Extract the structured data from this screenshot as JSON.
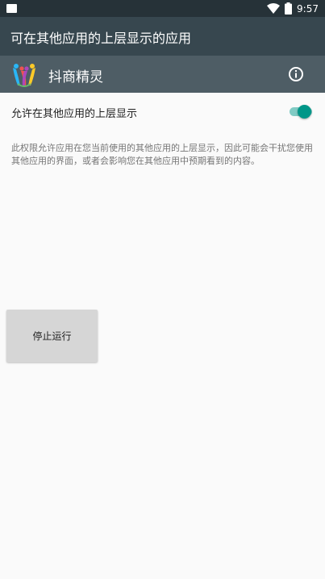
{
  "status_bar": {
    "time": "9:57",
    "icons": [
      "sd-card-icon",
      "wifi-icon",
      "battery-icon"
    ]
  },
  "toolbar": {
    "title": "可在其他应用的上层显示的应用"
  },
  "app": {
    "name": "抖商精灵",
    "icon": "app-logo-icon",
    "info_icon": "info-icon"
  },
  "setting": {
    "label": "允许在其他应用的上层显示",
    "enabled": true
  },
  "description": "此权限允许应用在您当前使用的其他应用的上层显示，因此可能会干扰您使用其他应用的界面，或者会影响您在其他应用中预期看到的内容。",
  "actions": {
    "stop_label": "停止运行"
  },
  "colors": {
    "statusbar": "#263238",
    "toolbar": "#37474f",
    "appbar": "#4e5d65",
    "accent": "#009688",
    "accent_track": "#80cbc4",
    "button": "#d6d6d6"
  }
}
